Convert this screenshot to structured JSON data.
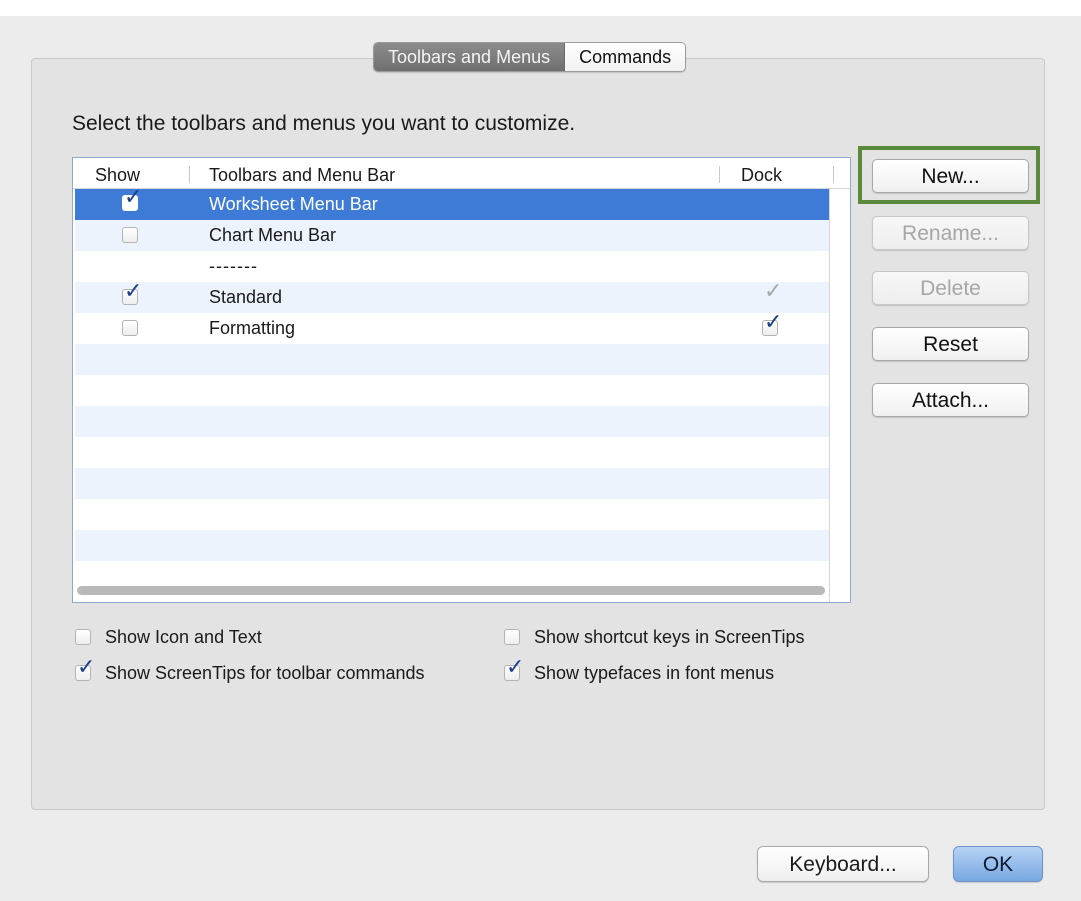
{
  "tabs": [
    {
      "label": "Toolbars and Menus",
      "active": true
    },
    {
      "label": "Commands",
      "active": false
    }
  ],
  "instruction": "Select the toolbars and menus you want to customize.",
  "table": {
    "columns": [
      "Show",
      "Toolbars and Menu Bar",
      "Dock"
    ],
    "rows": [
      {
        "name": "Worksheet Menu Bar",
        "show": true,
        "dock": null,
        "selected": true
      },
      {
        "name": "Chart Menu Bar",
        "show": false,
        "dock": null,
        "selected": false
      },
      {
        "name": "-------",
        "show": null,
        "dock": null,
        "selected": false
      },
      {
        "name": "Standard",
        "show": true,
        "dock": "disabled-checked",
        "selected": false
      },
      {
        "name": "Formatting",
        "show": false,
        "dock": true,
        "selected": false
      }
    ]
  },
  "side_buttons": {
    "new": "New...",
    "rename": "Rename...",
    "delete": "Delete",
    "reset": "Reset",
    "attach": "Attach..."
  },
  "options": {
    "show_icon_text": {
      "label": "Show Icon and Text",
      "checked": false
    },
    "show_screentips": {
      "label": "Show ScreenTips for toolbar commands",
      "checked": true
    },
    "show_shortcut_keys": {
      "label": "Show shortcut keys in ScreenTips",
      "checked": false
    },
    "show_typefaces": {
      "label": "Show typefaces in font menus",
      "checked": true
    }
  },
  "footer": {
    "keyboard": "Keyboard...",
    "ok": "OK"
  },
  "colors": {
    "highlight_border": "#5c8a3c",
    "selection": "#3d7bd6",
    "checkmark": "#1c3f8a"
  }
}
